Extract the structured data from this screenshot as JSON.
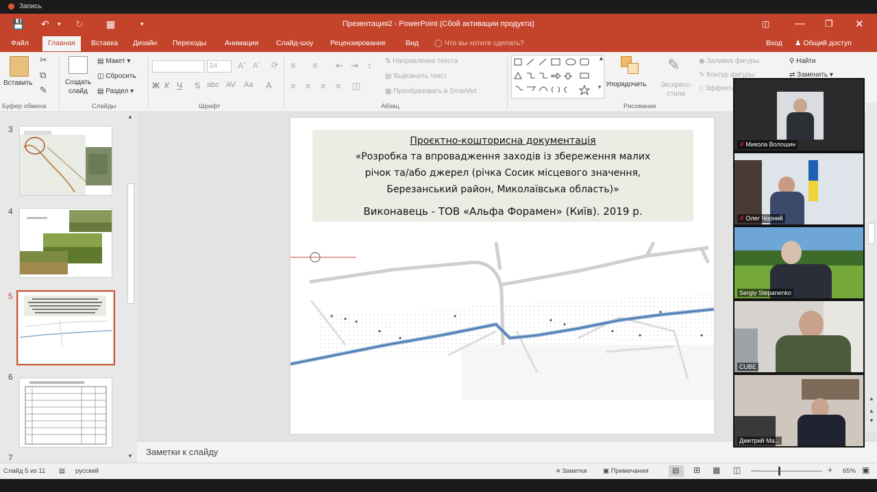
{
  "recorder": {
    "label": "Запись"
  },
  "app": {
    "title": "Презентация2 - PowerPoint (Сбой активации продукта)"
  },
  "tabs": [
    "Файл",
    "Главная",
    "Вставка",
    "Дизайн",
    "Переходы",
    "Анимация",
    "Слайд-шоу",
    "Рецензирование",
    "Вид"
  ],
  "tell_me": "Что вы хотите сделать?",
  "account": {
    "signin": "Вход",
    "share": "Общий доступ"
  },
  "ribbon": {
    "clipboard": {
      "paste": "Вставить",
      "group": "Буфер обмена"
    },
    "slides": {
      "new_slide": "Создать слайд",
      "layout": "Макет",
      "reset": "Сбросить",
      "section": "Раздел",
      "group": "Слайды"
    },
    "font": {
      "size": "24",
      "group": "Шрифт",
      "format_letters": [
        "Ж",
        "К",
        "Ч",
        "S"
      ]
    },
    "paragraph": {
      "text_direction": "Направление текста",
      "align_text": "Выровнять текст",
      "smartart": "Преобразовать в SmartArt",
      "group": "Абзац"
    },
    "drawing": {
      "arrange": "Упорядочить",
      "quick_styles": "Экспресс-стили",
      "shape_fill": "Заливка фигуры",
      "shape_outline": "Контур фигуры",
      "shape_effects": "Эффекты",
      "group": "Рисование"
    },
    "editing": {
      "find": "Найти",
      "replace": "Заменить"
    }
  },
  "thumbnails": [
    {
      "number": "3",
      "selected": false
    },
    {
      "number": "4",
      "selected": false
    },
    {
      "number": "5",
      "selected": true
    },
    {
      "number": "6",
      "selected": false
    },
    {
      "number": "7",
      "selected": false
    }
  ],
  "slide": {
    "title_lines": [
      "Проєктно-кошторисна документація",
      "«Розробка та впровадження заходів із збереження малих",
      "річок та/або джерел (річка Сосик місцевого значення,",
      "Березанський район, Миколаївська область)»"
    ],
    "executor": "Виконавець - ТОВ «Альфа Форамен» (Київ).  2019 р."
  },
  "notes_placeholder": "Заметки к слайду",
  "status": {
    "slide_counter": "Слайд 5 из 11",
    "language": "русский",
    "notes": "Заметки",
    "comments": "Примечания",
    "zoom": "65%"
  },
  "participants": [
    {
      "name": "Микола Волошин",
      "muted": true
    },
    {
      "name": "Олег Чорний",
      "muted": true
    },
    {
      "name": "Sergiy Stepanenko",
      "muted": false
    },
    {
      "name": "CUBE",
      "muted": false
    },
    {
      "name": "Дмитрий Ma...",
      "muted": false
    }
  ],
  "colors": {
    "accent": "#c4442b",
    "selection": "#d35230",
    "muted_mic": "#e22233"
  }
}
